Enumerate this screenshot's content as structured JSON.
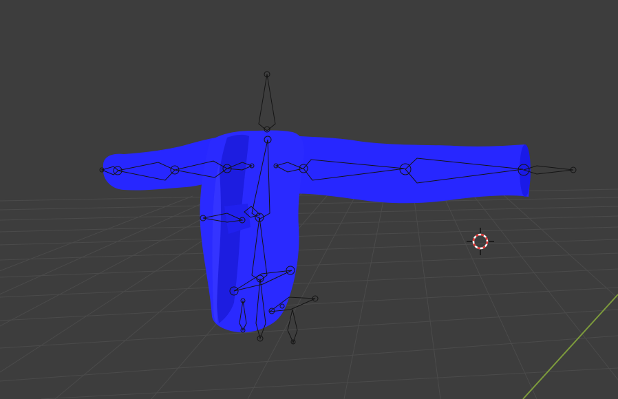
{
  "viewport": {
    "background": "#3d3d3d",
    "grid_color": "#4a4a4a",
    "x_axis_color": "#7a9a3a",
    "mesh_color": "#2424ff",
    "mesh_shadow_color": "#0f0fc8",
    "bone_outline_color": "#141414",
    "cursor_colors": [
      "#e03030",
      "#ffffff"
    ]
  },
  "objects": [
    {
      "id": "mesh",
      "kind": "mesh",
      "shading": "solid",
      "icon": "jacket-mesh"
    },
    {
      "id": "armature",
      "kind": "armature",
      "display": "octahedral",
      "icon": "armature-bones"
    },
    {
      "id": "3d-cursor",
      "kind": "cursor",
      "icon": "3d-cursor-icon"
    }
  ]
}
